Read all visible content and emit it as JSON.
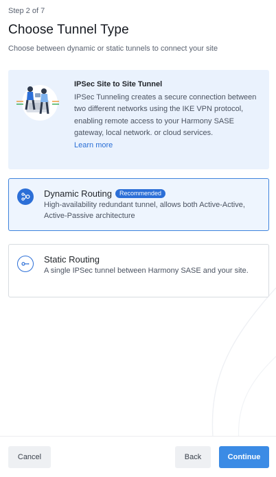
{
  "header": {
    "step": "Step 2 of 7",
    "title": "Choose Tunnel Type",
    "subtitle": "Choose between dynamic or static tunnels to connect your site"
  },
  "info_card": {
    "title": "IPSec Site to Site Tunnel",
    "body": "IPSec Tunneling creates a secure connection between two different networks using the IKE VPN protocol, enabling remote access to your Harmony SASE gateway, local network. or cloud services.",
    "link": "Learn more",
    "illustration": "people-at-gateway-illustration"
  },
  "options": [
    {
      "title": "Dynamic Routing",
      "badge": "Recommended",
      "description": "High-availability redundant tunnel, allows both Active-Active, Active-Passive architecture",
      "icon": "dynamic-routing-icon",
      "selected": true
    },
    {
      "title": "Static Routing",
      "description": "A single IPSec tunnel between Harmony SASE and your site.",
      "icon": "static-routing-icon",
      "selected": false
    }
  ],
  "footer": {
    "cancel_label": "Cancel",
    "back_label": "Back",
    "continue_label": "Continue"
  },
  "colors": {
    "accent": "#2c6fd7",
    "primary_button": "#3b8be5",
    "info_background": "#eaf2fd",
    "selected_background": "#eef5fe"
  }
}
